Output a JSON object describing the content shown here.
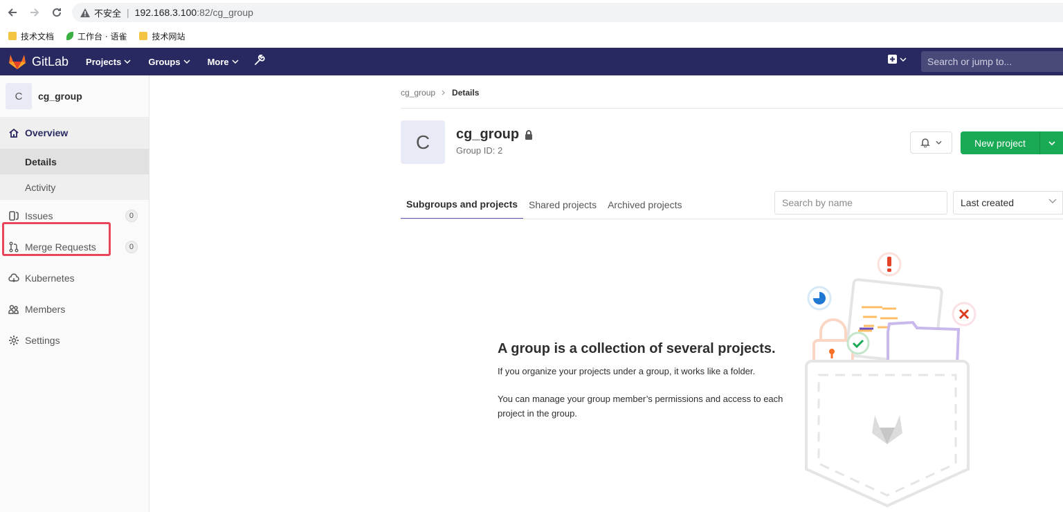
{
  "browser": {
    "insecure_label": "不安全",
    "url_host": "192.168.3.100",
    "url_path": ":82/cg_group",
    "bookmarks": [
      {
        "label": "技术文档",
        "icon": "folder-icon"
      },
      {
        "label": "工作台 · 语雀",
        "icon": "yuque-leaf-icon"
      },
      {
        "label": "技术网站",
        "icon": "folder-icon"
      }
    ]
  },
  "topnav": {
    "brand": "GitLab",
    "items": [
      "Projects",
      "Groups",
      "More"
    ],
    "search_placeholder": "Search or jump to..."
  },
  "sidebar": {
    "avatar_letter": "C",
    "group_name": "cg_group",
    "overview": "Overview",
    "sub_items": [
      "Details",
      "Activity"
    ],
    "items": [
      {
        "label": "Issues",
        "icon": "issues-icon",
        "count": "0"
      },
      {
        "label": "Merge Requests",
        "icon": "merge-request-icon",
        "count": "0"
      },
      {
        "label": "Kubernetes",
        "icon": "kubernetes-icon"
      },
      {
        "label": "Members",
        "icon": "members-icon"
      },
      {
        "label": "Settings",
        "icon": "settings-icon"
      }
    ]
  },
  "breadcrumb": {
    "parent": "cg_group",
    "current": "Details"
  },
  "group": {
    "avatar_letter": "C",
    "name": "cg_group",
    "id_text": "Group ID: 2"
  },
  "actions": {
    "new_project": "New project"
  },
  "tabs": [
    "Subgroups and projects",
    "Shared projects",
    "Archived projects"
  ],
  "filter": {
    "placeholder": "Search by name",
    "sort_value": "Last created"
  },
  "empty_state": {
    "title": "A group is a collection of several projects.",
    "line1": "If you organize your projects under a group, it works like a folder.",
    "line2": "You can manage your group member’s permissions and access to each project in the group."
  },
  "colors": {
    "nav_bg": "#292961",
    "primary_green": "#1aaa55",
    "tab_accent": "#6b4fbb",
    "highlight_red": "#e8455a"
  }
}
